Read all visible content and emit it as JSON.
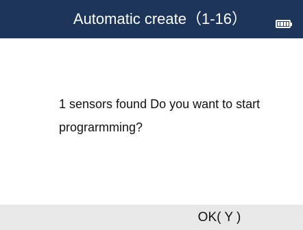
{
  "header": {
    "title": "Automatic create（1-16）",
    "battery_icon": "battery-full-icon"
  },
  "dialog": {
    "message": "1 sensors found Do you want to start prograrmming?"
  },
  "footer": {
    "ok_label": "OK( Y )"
  },
  "colors": {
    "header_bg": "#1c3559",
    "footer_bg": "#e8e8e8"
  }
}
